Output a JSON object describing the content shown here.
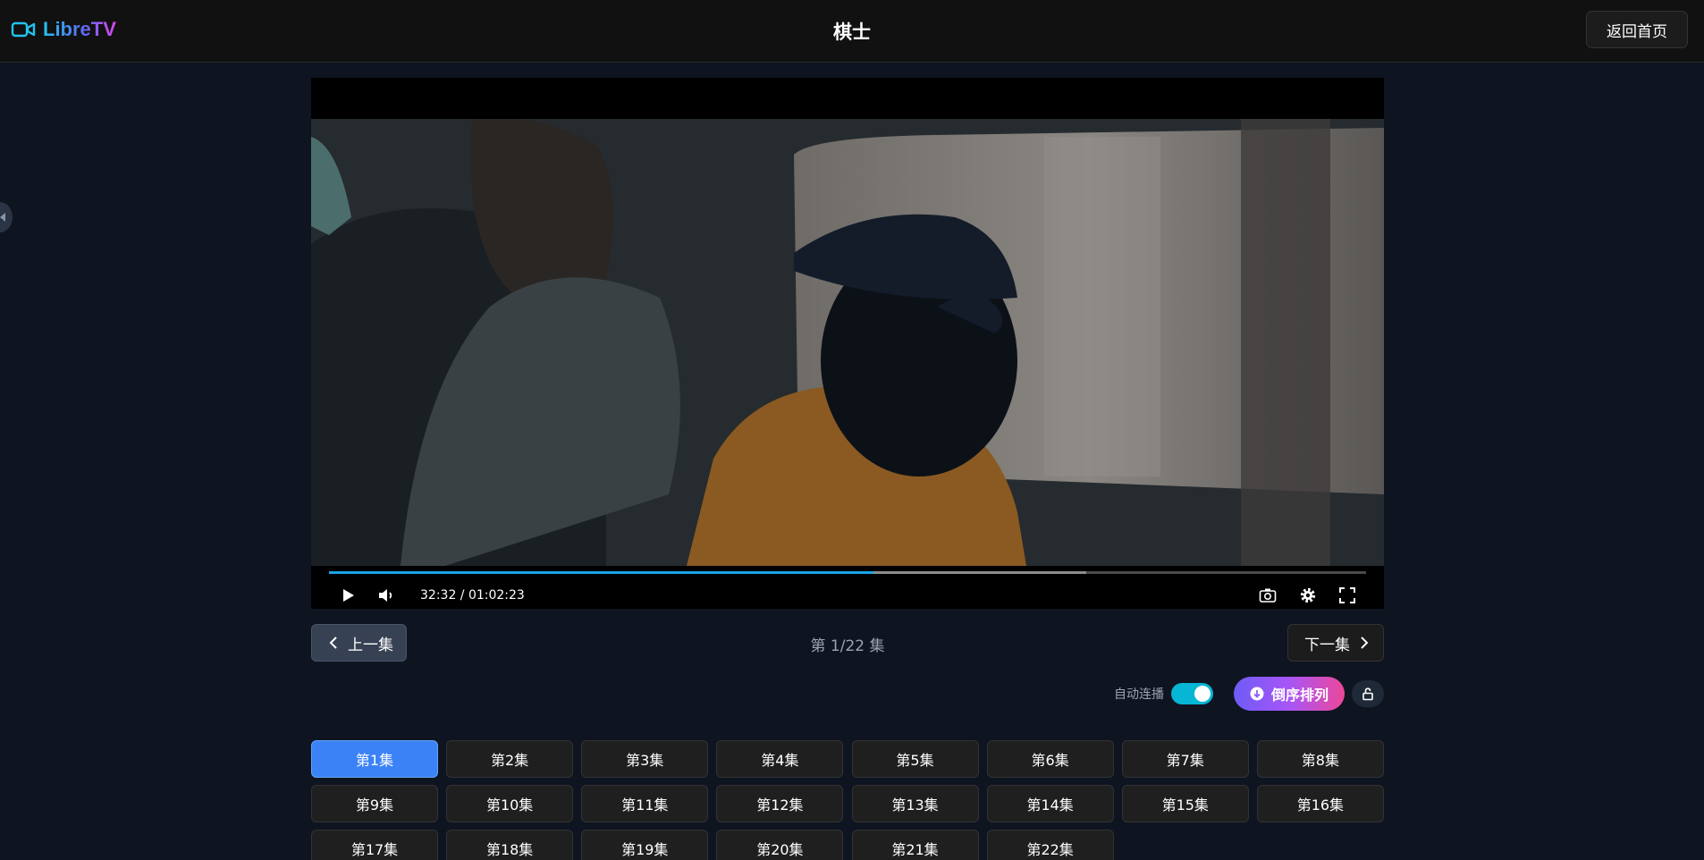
{
  "app": {
    "name": "LibreTV",
    "brand_colors": [
      "#22c3ee",
      "#5b6bf2",
      "#d946ef"
    ]
  },
  "header": {
    "title": "棋士",
    "home_button": "返回首页"
  },
  "player": {
    "time_display": "32:32 / 01:02:23",
    "progress_played_percent": 52.5,
    "progress_buffered_percent": 73,
    "accent_color": "#19a3e5",
    "controls": [
      "play-icon",
      "volume-icon",
      "screenshot-icon",
      "settings-icon",
      "fullscreen-icon"
    ]
  },
  "navigation": {
    "prev_label": "上一集",
    "next_label": "下一集",
    "counter": "第 1/22 集"
  },
  "options": {
    "autoplay_label": "自动连播",
    "autoplay_on": true,
    "sort_label": "倒序排列"
  },
  "episodes": {
    "active_index": 0,
    "items": [
      "第1集",
      "第2集",
      "第3集",
      "第4集",
      "第5集",
      "第6集",
      "第7集",
      "第8集",
      "第9集",
      "第10集",
      "第11集",
      "第12集",
      "第13集",
      "第14集",
      "第15集",
      "第16集",
      "第17集",
      "第18集",
      "第19集",
      "第20集",
      "第21集",
      "第22集"
    ]
  }
}
